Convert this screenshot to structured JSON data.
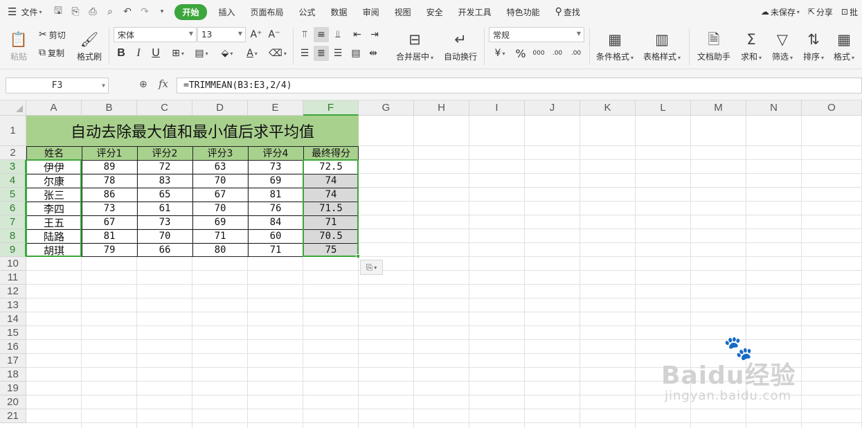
{
  "menu": {
    "file": "文件",
    "tabs": [
      "开始",
      "插入",
      "页面布局",
      "公式",
      "数据",
      "审阅",
      "视图",
      "安全",
      "开发工具",
      "特色功能"
    ],
    "active_tab": "开始",
    "search": "查找",
    "unsaved": "未保存",
    "share": "分享",
    "comment": "批"
  },
  "ribbon": {
    "paste": "粘贴",
    "cut": "剪切",
    "copy": "复制",
    "format_painter": "格式刷",
    "font_name": "宋体",
    "font_size": "13",
    "bold": "B",
    "italic": "I",
    "underline": "U",
    "merge_center": "合并居中",
    "wrap_text": "自动换行",
    "number_format": "常规",
    "percent": "%",
    "thousands": "000",
    "inc_decimal": ".00",
    "dec_decimal": ".00",
    "conditional_format": "条件格式",
    "table_style": "表格样式",
    "doc_assistant": "文档助手",
    "sum": "求和",
    "filter": "筛选",
    "sort": "排序",
    "format": "格式"
  },
  "formula_bar": {
    "cell_ref": "F3",
    "fx": "fx",
    "formula": "=TRIMMEAN(B3:E3,2/4)"
  },
  "columns": [
    "A",
    "B",
    "C",
    "D",
    "E",
    "F",
    "G",
    "H",
    "I",
    "J",
    "K",
    "L",
    "M",
    "N",
    "O"
  ],
  "rows": [
    "1",
    "2",
    "3",
    "4",
    "5",
    "6",
    "7",
    "8",
    "9",
    "10",
    "11",
    "12",
    "13",
    "14",
    "15",
    "16",
    "17",
    "18",
    "19",
    "20",
    "21"
  ],
  "selected_column": "F",
  "sheet": {
    "title": "自动去除最大值和最小值后求平均值",
    "headers": [
      "姓名",
      "评分1",
      "评分2",
      "评分3",
      "评分4",
      "最终得分"
    ],
    "data": [
      [
        "伊伊",
        "89",
        "72",
        "63",
        "73",
        "72.5"
      ],
      [
        "尔康",
        "78",
        "83",
        "70",
        "69",
        "74"
      ],
      [
        "张三",
        "86",
        "65",
        "67",
        "81",
        "74"
      ],
      [
        "李四",
        "73",
        "61",
        "70",
        "76",
        "71.5"
      ],
      [
        "王五",
        "67",
        "73",
        "69",
        "84",
        "71"
      ],
      [
        "陆路",
        "81",
        "70",
        "71",
        "60",
        "70.5"
      ],
      [
        "胡琪",
        "79",
        "66",
        "80",
        "71",
        "75"
      ]
    ]
  },
  "watermark": {
    "brand": "Bai",
    "brand2": "du",
    "brand3": "经验",
    "url": "jingyan.baidu.com"
  },
  "colors": {
    "accent": "#3ca63c",
    "header_fill": "#a9d18e",
    "selection_fill": "#d9d9d9"
  }
}
